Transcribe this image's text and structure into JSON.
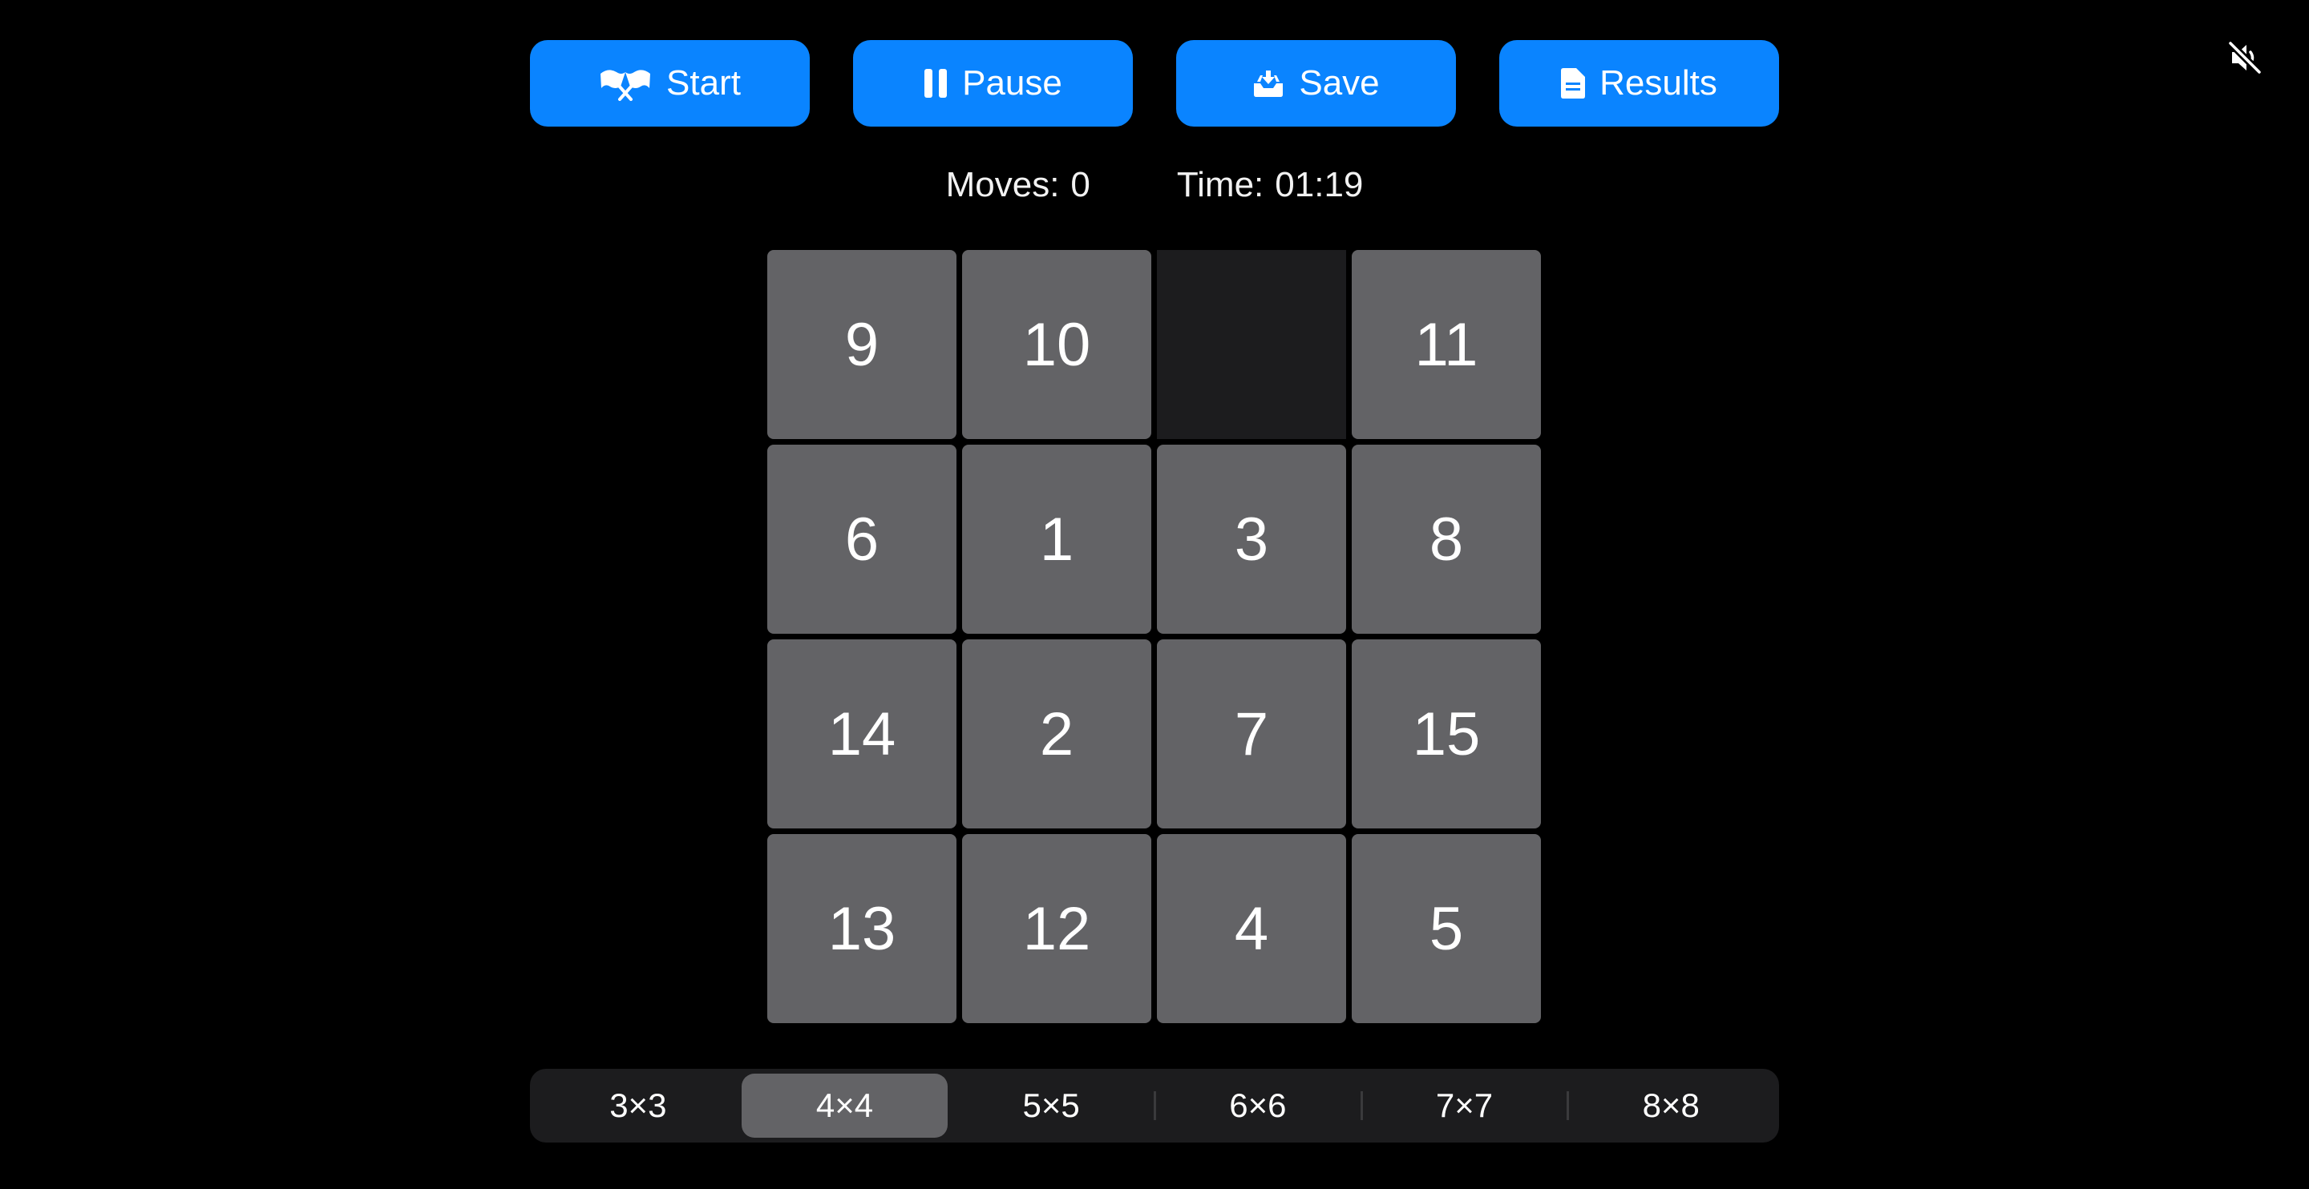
{
  "toolbar": {
    "start_label": "Start",
    "pause_label": "Pause",
    "save_label": "Save",
    "results_label": "Results",
    "icons": {
      "start": "checkered-flags-icon",
      "pause": "pause-icon",
      "save": "tray-download-icon",
      "results": "document-icon",
      "mute": "speaker-muted-icon"
    }
  },
  "stats": {
    "moves_label": "Moves:",
    "moves_value": "0",
    "time_label": "Time:",
    "time_value": "01:19"
  },
  "board": {
    "rows": 4,
    "cols": 4,
    "tiles": [
      "9",
      "10",
      "",
      "11",
      "6",
      "1",
      "3",
      "8",
      "14",
      "2",
      "7",
      "15",
      "13",
      "12",
      "4",
      "5"
    ]
  },
  "sizes": {
    "options": [
      "3×3",
      "4×4",
      "5×5",
      "6×6",
      "7×7",
      "8×8"
    ],
    "selected": "4×4"
  },
  "colors": {
    "accent": "#0a84ff",
    "tile": "#636366",
    "empty": "#1c1c1e",
    "background": "#000000"
  }
}
